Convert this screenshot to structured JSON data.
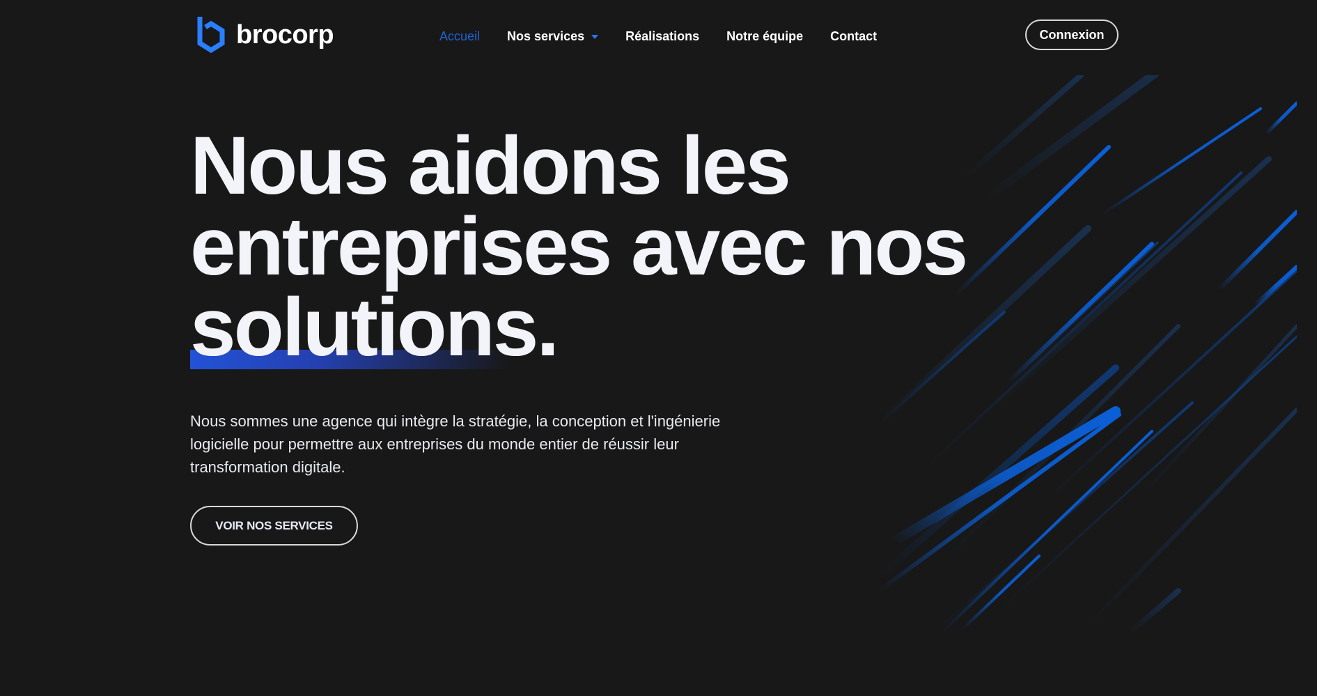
{
  "header": {
    "logo_text": "brocorp",
    "nav": [
      {
        "label": "Accueil"
      },
      {
        "label": "Nos services"
      },
      {
        "label": "Réalisations"
      },
      {
        "label": "Notre équipe"
      },
      {
        "label": "Contact"
      }
    ],
    "login_label": "Connexion"
  },
  "hero": {
    "title_lines": [
      "Nous aidons les",
      "entreprises avec nos",
      "solutions."
    ],
    "description": "Nous sommes une agence qui intègre la stratégie, la conception et l'ingénierie logicielle pour permettre aux entreprises du monde entier de réussir leur transformation digitale.",
    "cta_label": "VOIR NOS SERVICES"
  },
  "colors": {
    "background": "#181818",
    "accent": "#1e63d6",
    "text": "#f3f4f9"
  },
  "icons": {
    "logo": "brocorp-hexagon-b-logo",
    "nav_dropdown": "caret-down-icon"
  }
}
